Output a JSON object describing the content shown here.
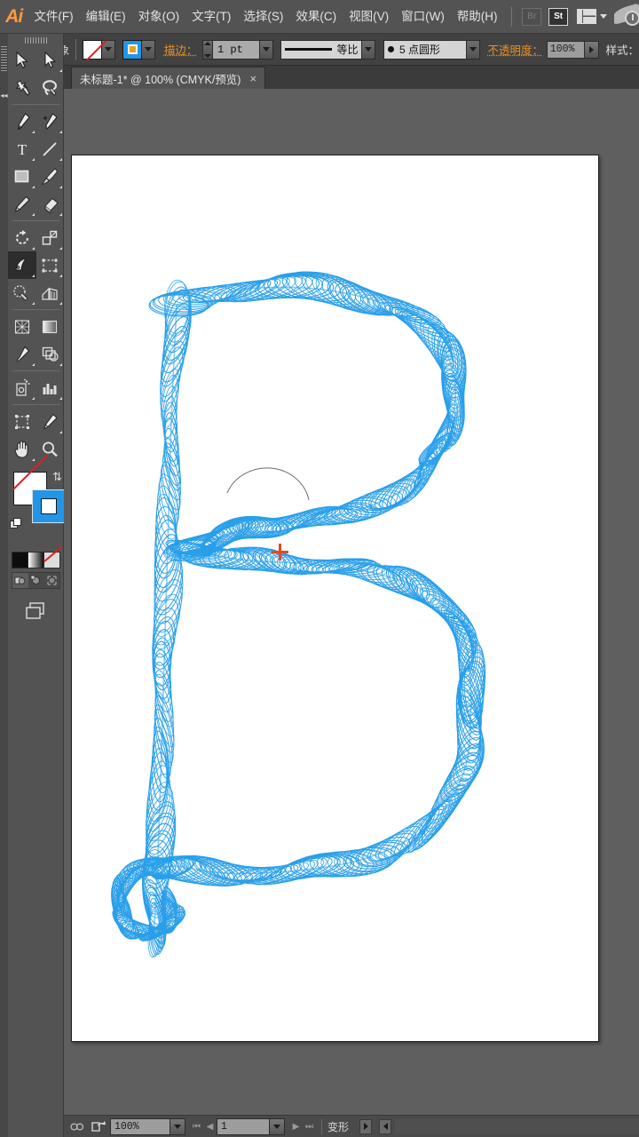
{
  "app": {
    "logo": "Ai",
    "title": "Adobe Illustrator"
  },
  "menubar": {
    "items": [
      {
        "label": "文件(F)"
      },
      {
        "label": "编辑(E)"
      },
      {
        "label": "对象(O)"
      },
      {
        "label": "文字(T)"
      },
      {
        "label": "选择(S)"
      },
      {
        "label": "效果(C)"
      },
      {
        "label": "视图(V)"
      },
      {
        "label": "窗口(W)"
      },
      {
        "label": "帮助(H)"
      }
    ],
    "bridge_label": "Br",
    "stock_label": "St",
    "workspace_icon": "workspace-switcher-icon",
    "search_icon": "cc-swoosh-icon"
  },
  "controlbar": {
    "selection_status": "未选择对象",
    "fill_label": "fill-swatch",
    "stroke_swatch_label": "stroke-swatch",
    "stroke_label": "描边：",
    "stroke_weight": "1 pt",
    "profile_label": "等比",
    "brush_label": "5 点圆形",
    "opacity_label": "不透明度：",
    "opacity_value": "100%",
    "style_label": "样式："
  },
  "tabs": {
    "documents": [
      {
        "title": "未标题-1* @ 100% (CMYK/预览)",
        "close": "×",
        "active": true
      }
    ]
  },
  "toolbar": {
    "rows": [
      [
        {
          "name": "selection-tool",
          "glyph": "arrow-solid"
        },
        {
          "name": "direct-selection-tool",
          "glyph": "arrow-hollow"
        }
      ],
      [
        {
          "name": "magic-wand-tool",
          "glyph": "wand"
        },
        {
          "name": "lasso-tool",
          "glyph": "lasso"
        }
      ],
      [
        {
          "name": "pen-tool",
          "glyph": "pen"
        },
        {
          "name": "add-anchor-point-tool",
          "glyph": "pen-plus"
        }
      ],
      [
        {
          "name": "type-tool",
          "glyph": "T"
        },
        {
          "name": "line-segment-tool",
          "glyph": "line"
        }
      ],
      [
        {
          "name": "rectangle-tool",
          "glyph": "rect"
        },
        {
          "name": "paintbrush-tool",
          "glyph": "brush"
        }
      ],
      [
        {
          "name": "pencil-tool",
          "glyph": "pencil"
        },
        {
          "name": "eraser-tool",
          "glyph": "eraser"
        }
      ],
      [
        {
          "name": "rotate-tool",
          "glyph": "rotate"
        },
        {
          "name": "scale-tool",
          "glyph": "scale"
        }
      ],
      [
        {
          "name": "width-tool",
          "glyph": "warp",
          "selected": true
        },
        {
          "name": "free-transform-tool",
          "glyph": "freetransform"
        }
      ],
      [
        {
          "name": "shape-builder-tool",
          "glyph": "shapebuilder"
        },
        {
          "name": "column-graph-tool",
          "glyph": "graph"
        }
      ],
      [
        {
          "name": "mesh-tool",
          "glyph": "mesh"
        },
        {
          "name": "gradient-tool",
          "glyph": "gradient"
        }
      ],
      [
        {
          "name": "eyedropper-tool",
          "glyph": "eyedropper"
        },
        {
          "name": "blend-tool",
          "glyph": "blend"
        }
      ],
      [
        {
          "name": "symbol-sprayer-tool",
          "glyph": "sprayer"
        },
        {
          "name": "bar-graph-tool",
          "glyph": "bargraph"
        }
      ],
      [
        {
          "name": "artboard-tool",
          "glyph": "artboard"
        },
        {
          "name": "slice-tool",
          "glyph": "slice"
        }
      ],
      [
        {
          "name": "hand-tool",
          "glyph": "hand"
        },
        {
          "name": "zoom-tool",
          "glyph": "magnifier"
        }
      ]
    ],
    "fill_swatch": {
      "name": "fill-none-swatch",
      "value": "none"
    },
    "stroke_swatch": {
      "name": "stroke-color-swatch",
      "value": "#2196e8"
    },
    "swap_icon": "swap-fill-stroke-icon",
    "default_icon": "default-fill-stroke-icon",
    "color_modes": [
      {
        "name": "color-mode-button",
        "value": "#0d0d0d"
      },
      {
        "name": "gradient-mode-button",
        "value": "gradient"
      },
      {
        "name": "none-mode-button",
        "value": "none"
      }
    ],
    "draw_modes": [
      {
        "name": "draw-normal-button",
        "active": true
      },
      {
        "name": "draw-behind-button",
        "active": false
      },
      {
        "name": "draw-inside-button",
        "active": false
      }
    ],
    "screen_mode": {
      "name": "change-screen-mode-button"
    }
  },
  "canvas": {
    "artwork_name": "spiral-letter-b-artwork",
    "stroke_color": "#1e9ae8",
    "background": "#ffffff",
    "cursor": "width-tool-crosshair"
  },
  "statusbar": {
    "preflight_icon": "preflight-icon",
    "export_icon": "export-icon",
    "zoom_value": "100%",
    "page_value": "1",
    "nav_first": "⏮",
    "nav_prev": "◀",
    "nav_next": "▶",
    "nav_last": "⏭",
    "status_label": "变形"
  },
  "chart_data": null
}
